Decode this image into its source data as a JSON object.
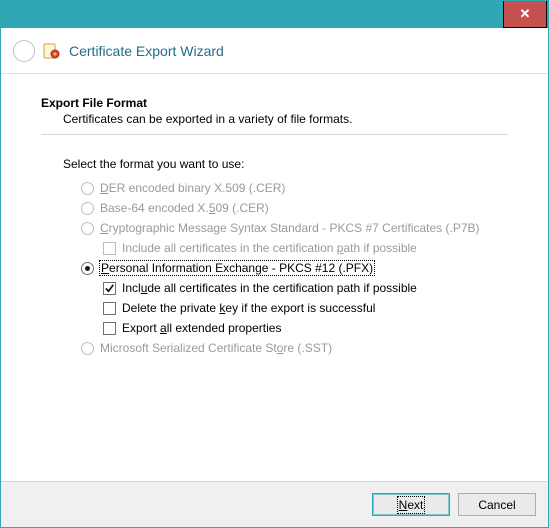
{
  "titlebar": {
    "close_label": "✕"
  },
  "header": {
    "title": "Certificate Export Wizard"
  },
  "section": {
    "heading": "Export File Format",
    "description": "Certificates can be exported in a variety of file formats."
  },
  "prompt": "Select the format you want to use:",
  "options": {
    "der": {
      "pre": "",
      "u": "D",
      "post": "ER encoded binary X.509 (.CER)"
    },
    "base64": {
      "pre": "Base-64 encoded X.",
      "u": "5",
      "post": "09 (.CER)"
    },
    "p7b": {
      "pre": "",
      "u": "C",
      "post": "ryptographic Message Syntax Standard - PKCS #7 Certificates (.P7B)"
    },
    "p7b_sub": {
      "pre": "Include all certificates in the certification ",
      "u": "p",
      "post": "ath if possible"
    },
    "pfx": {
      "pre": "",
      "u": "P",
      "post": "ersonal Information Exchange - PKCS #12 (.PFX)"
    },
    "pfx_sub1": {
      "pre": "Incl",
      "u": "u",
      "post": "de all certificates in the certification path if possible"
    },
    "pfx_sub2": {
      "pre": "Delete the private ",
      "u": "k",
      "post": "ey if the export is successful"
    },
    "pfx_sub3": {
      "pre": "Export ",
      "u": "a",
      "post": "ll extended properties"
    },
    "sst": {
      "pre": "Microsoft Serialized Certificate St",
      "u": "o",
      "post": "re (.SST)"
    }
  },
  "footer": {
    "next": {
      "u": "N",
      "post": "ext"
    },
    "cancel": "Cancel"
  }
}
